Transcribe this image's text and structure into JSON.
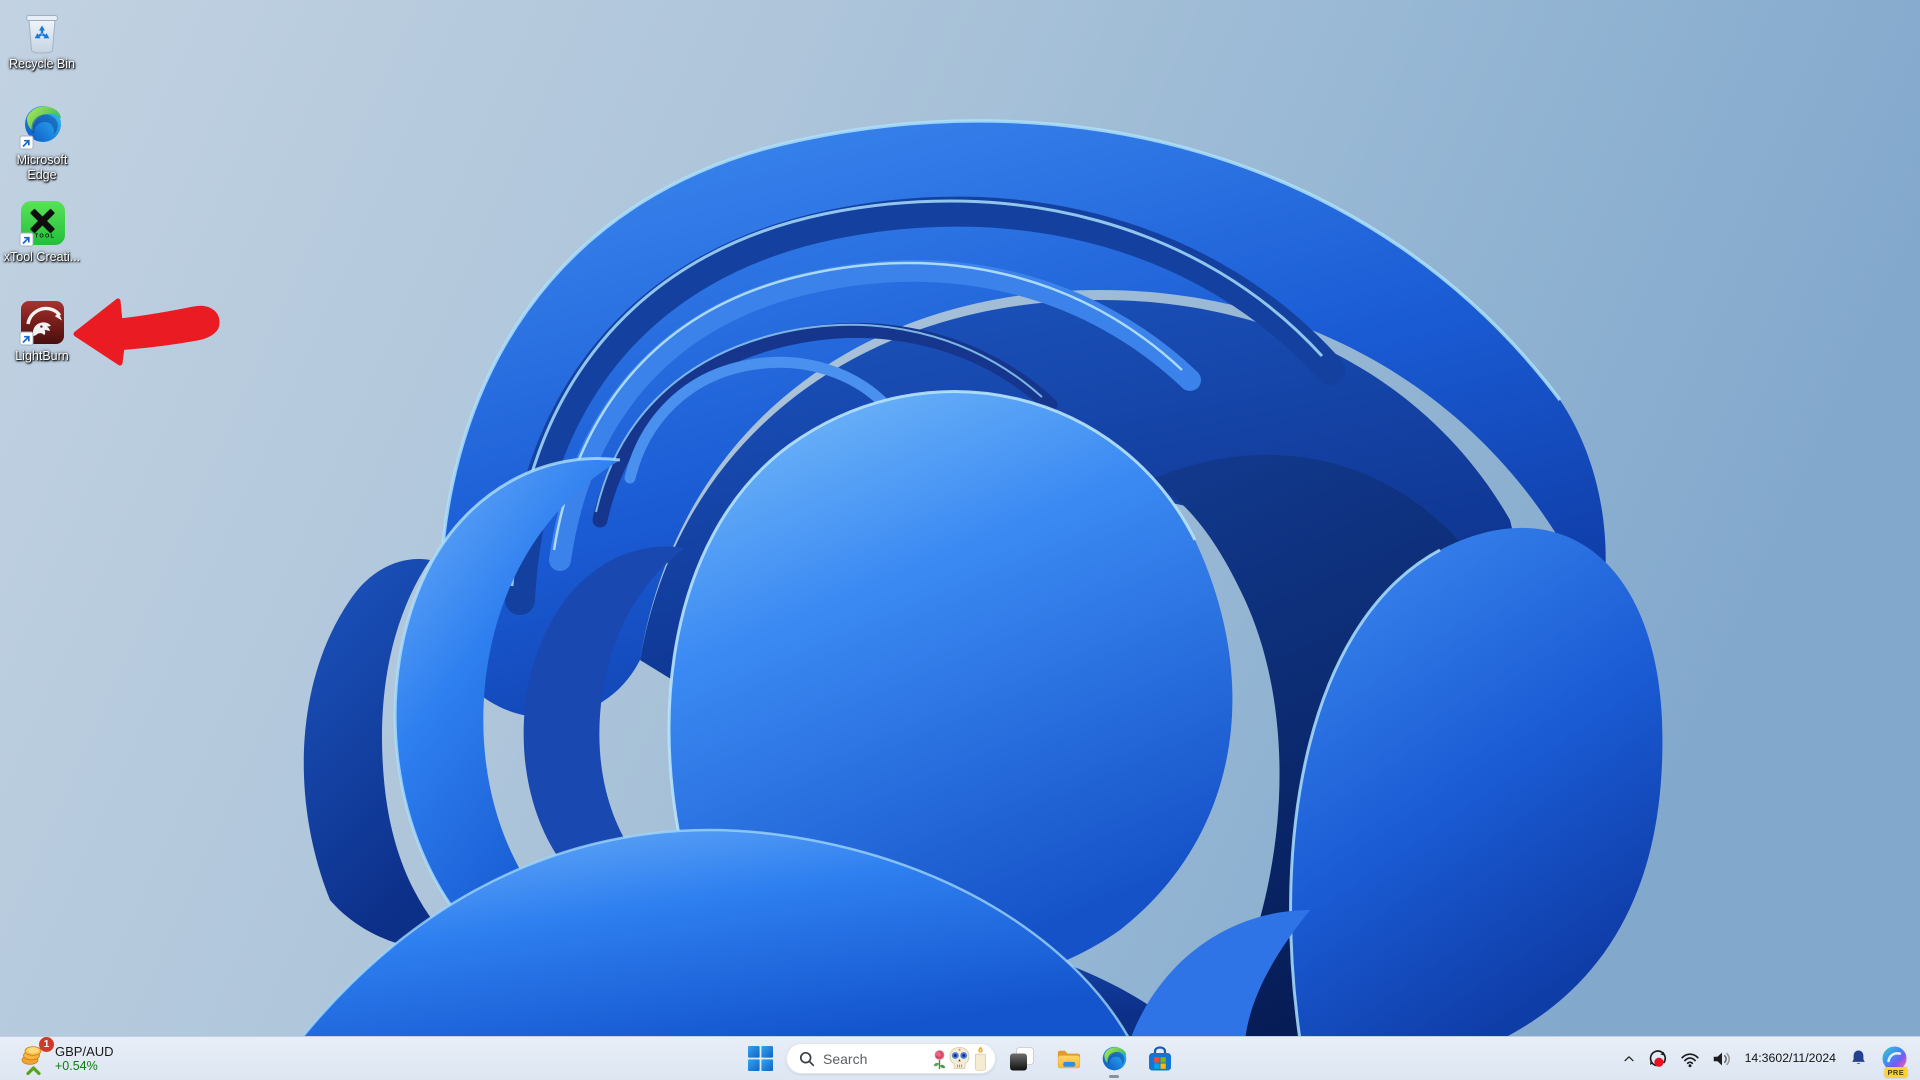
{
  "wallpaper": {
    "name": "windows-11-bloom",
    "dominant_color": "#2268e0",
    "background_top_left": "#bfd1e2",
    "background_right": "#84aacd"
  },
  "desktop": {
    "icons": [
      {
        "label": "Recycle Bin"
      },
      {
        "label": "Microsoft Edge"
      },
      {
        "label": "xTool Creati..."
      },
      {
        "label": "LightBurn"
      }
    ]
  },
  "annotation": {
    "type": "hand-drawn-arrow",
    "color": "#ea1b22",
    "points_to": "LightBurn desktop icon"
  },
  "taskbar": {
    "widget": {
      "badge_count": "1",
      "pair": "GBP/AUD",
      "change": "+0.54%",
      "change_color": "#0c7c10",
      "badge_color": "#cf3b2a"
    },
    "search": {
      "placeholder": "Search"
    },
    "tray": {
      "time": "14:36",
      "date": "02/11/2024",
      "copilot_badge": "PRE"
    }
  },
  "icons": {
    "desktop": [
      "recycle-bin-icon",
      "edge-icon",
      "xtool-icon",
      "lightburn-icon",
      "shortcut-arrow-icon"
    ],
    "taskbar_center": [
      "windows-start-icon",
      "search-icon",
      "rose-icon",
      "sugar-skull-icon",
      "candle-icon",
      "task-view-icon",
      "file-explorer-icon",
      "edge-icon",
      "microsoft-store-icon"
    ],
    "taskbar_left": [
      "coins-icon",
      "trend-up-icon"
    ],
    "tray": [
      "chevron-up-icon",
      "sync-alert-icon",
      "wifi-icon",
      "volume-icon",
      "notification-bell-icon",
      "copilot-icon"
    ]
  }
}
